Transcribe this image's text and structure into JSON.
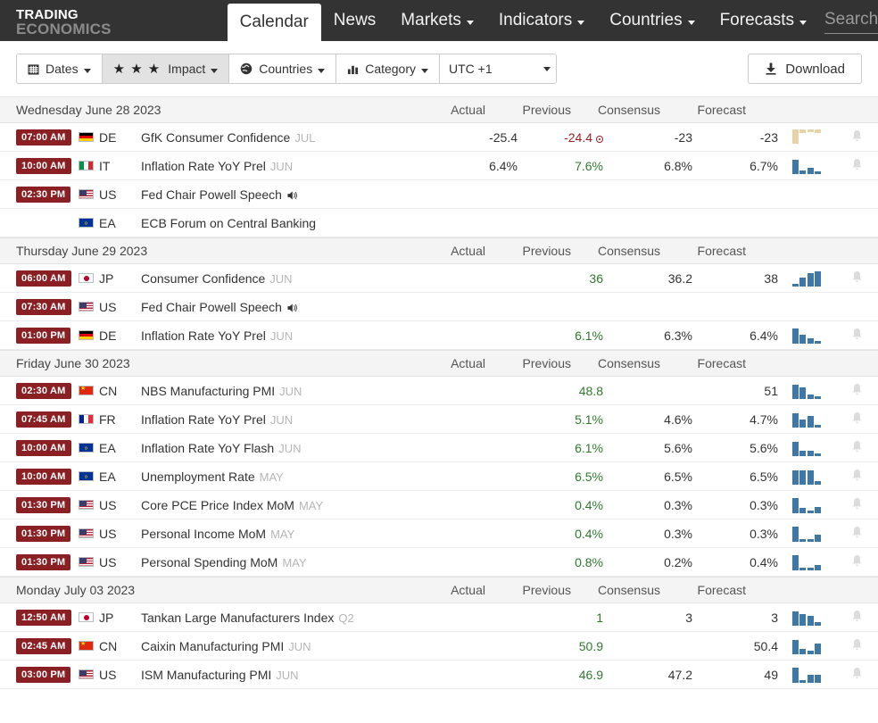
{
  "nav": {
    "brand_line1": "TRADING",
    "brand_line2": "ECONOMICS",
    "items": [
      {
        "label": "Calendar",
        "active": true,
        "caret": false
      },
      {
        "label": "News",
        "active": false,
        "caret": false
      },
      {
        "label": "Markets",
        "active": false,
        "caret": true
      },
      {
        "label": "Indicators",
        "active": false,
        "caret": true
      },
      {
        "label": "Countries",
        "active": false,
        "caret": true
      },
      {
        "label": "Forecasts",
        "active": false,
        "caret": true
      }
    ],
    "search_placeholder": "Search"
  },
  "toolbar": {
    "dates_label": "Dates",
    "impact_label": "Impact",
    "impact_stars": "★ ★ ★",
    "countries_label": "Countries",
    "category_label": "Category",
    "timezone_selected": "UTC +1",
    "timezone_options": [
      "UTC +1"
    ],
    "download_label": "Download"
  },
  "columns": {
    "actual": "Actual",
    "previous": "Previous",
    "consensus": "Consensus",
    "forecast": "Forecast"
  },
  "groups": [
    {
      "date": "Wednesday June 28 2023",
      "rows": [
        {
          "time": "07:00 AM",
          "country": "DE",
          "flag": "de",
          "event": "GfK Consumer Confidence",
          "period": "JUL",
          "actual": "-25.4",
          "actual_color": "plain",
          "previous": "-24.4",
          "previous_color": "red",
          "revised": true,
          "consensus": "-23",
          "forecast": "-23",
          "spark": {
            "color": "tan",
            "bars": [
              16,
              4,
              3,
              4
            ]
          },
          "bell": true
        },
        {
          "time": "10:00 AM",
          "country": "IT",
          "flag": "it",
          "event": "Inflation Rate YoY Prel",
          "period": "JUN",
          "actual": "6.4%",
          "actual_color": "plain",
          "previous": "7.6%",
          "previous_color": "green",
          "revised": false,
          "consensus": "6.8%",
          "forecast": "6.7%",
          "spark": {
            "color": "blue",
            "bars": [
              16,
              4,
              7,
              3
            ]
          },
          "bell": true
        },
        {
          "time": "02:30 PM",
          "country": "US",
          "flag": "us",
          "event": "Fed Chair Powell Speech",
          "period": "",
          "speaker": true,
          "actual": "",
          "previous": "",
          "consensus": "",
          "forecast": "",
          "spark": null,
          "bell": false
        },
        {
          "time": "",
          "country": "EA",
          "flag": "ea",
          "event": "ECB Forum on Central Banking",
          "period": "",
          "actual": "",
          "previous": "",
          "consensus": "",
          "forecast": "",
          "spark": null,
          "bell": false
        }
      ]
    },
    {
      "date": "Thursday June 29 2023",
      "rows": [
        {
          "time": "06:00 AM",
          "country": "JP",
          "flag": "jp",
          "event": "Consumer Confidence",
          "period": "JUN",
          "actual": "",
          "actual_color": "plain",
          "previous": "36",
          "previous_color": "green",
          "revised": false,
          "consensus": "36.2",
          "forecast": "38",
          "spark": {
            "color": "blue",
            "bars": [
              3,
              10,
              15,
              17
            ]
          },
          "bell": true
        },
        {
          "time": "07:30 AM",
          "country": "US",
          "flag": "us",
          "event": "Fed Chair Powell Speech",
          "period": "",
          "speaker": true,
          "actual": "",
          "previous": "",
          "consensus": "",
          "forecast": "",
          "spark": null,
          "bell": false
        },
        {
          "time": "01:00 PM",
          "country": "DE",
          "flag": "de",
          "event": "Inflation Rate YoY Prel",
          "period": "JUN",
          "actual": "",
          "actual_color": "plain",
          "previous": "6.1%",
          "previous_color": "green",
          "revised": false,
          "consensus": "6.3%",
          "forecast": "6.4%",
          "spark": {
            "color": "blue",
            "bars": [
              17,
              10,
              6,
              3
            ]
          },
          "bell": true
        }
      ]
    },
    {
      "date": "Friday June 30 2023",
      "rows": [
        {
          "time": "02:30 AM",
          "country": "CN",
          "flag": "cn",
          "event": "NBS Manufacturing PMI",
          "period": "JUN",
          "actual": "",
          "actual_color": "plain",
          "previous": "48.8",
          "previous_color": "green",
          "revised": false,
          "consensus": "",
          "forecast": "51",
          "spark": {
            "color": "blue",
            "bars": [
              16,
              13,
              5,
              3
            ]
          },
          "bell": true
        },
        {
          "time": "07:45 AM",
          "country": "FR",
          "flag": "fr",
          "event": "Inflation Rate YoY Prel",
          "period": "JUN",
          "actual": "",
          "actual_color": "plain",
          "previous": "5.1%",
          "previous_color": "green",
          "revised": false,
          "consensus": "4.6%",
          "forecast": "4.7%",
          "spark": {
            "color": "blue",
            "bars": [
              16,
              9,
              13,
              3
            ]
          },
          "bell": true
        },
        {
          "time": "10:00 AM",
          "country": "EA",
          "flag": "ea",
          "event": "Inflation Rate YoY Flash",
          "period": "JUN",
          "actual": "",
          "actual_color": "plain",
          "previous": "6.1%",
          "previous_color": "green",
          "revised": false,
          "consensus": "5.6%",
          "forecast": "5.6%",
          "spark": {
            "color": "blue",
            "bars": [
              16,
              6,
              6,
              3
            ]
          },
          "bell": true
        },
        {
          "time": "10:00 AM",
          "country": "EA",
          "flag": "ea",
          "event": "Unemployment Rate",
          "period": "MAY",
          "actual": "",
          "actual_color": "plain",
          "previous": "6.5%",
          "previous_color": "green",
          "revised": false,
          "consensus": "6.5%",
          "forecast": "6.5%",
          "spark": {
            "color": "blue",
            "bars": [
              16,
              16,
              16,
              4
            ]
          },
          "bell": true
        },
        {
          "time": "01:30 PM",
          "country": "US",
          "flag": "us",
          "event": "Core PCE Price Index MoM",
          "period": "MAY",
          "actual": "",
          "actual_color": "plain",
          "previous": "0.4%",
          "previous_color": "green",
          "revised": false,
          "consensus": "0.3%",
          "forecast": "0.3%",
          "spark": {
            "color": "blue",
            "bars": [
              17,
              6,
              3,
              7
            ]
          },
          "bell": true
        },
        {
          "time": "01:30 PM",
          "country": "US",
          "flag": "us",
          "event": "Personal Income MoM",
          "period": "MAY",
          "actual": "",
          "actual_color": "plain",
          "previous": "0.4%",
          "previous_color": "green",
          "revised": false,
          "consensus": "0.3%",
          "forecast": "0.3%",
          "spark": {
            "color": "blue",
            "bars": [
              17,
              3,
              3,
              8
            ]
          },
          "bell": true
        },
        {
          "time": "01:30 PM",
          "country": "US",
          "flag": "us",
          "event": "Personal Spending MoM",
          "period": "MAY",
          "actual": "",
          "actual_color": "plain",
          "previous": "0.8%",
          "previous_color": "green",
          "revised": false,
          "consensus": "0.2%",
          "forecast": "0.4%",
          "spark": {
            "color": "blue",
            "bars": [
              17,
              3,
              3,
              6
            ]
          },
          "bell": true
        }
      ]
    },
    {
      "date": "Monday July 03 2023",
      "rows": [
        {
          "time": "12:50 AM",
          "country": "JP",
          "flag": "jp",
          "event": "Tankan Large Manufacturers Index",
          "period": "Q2",
          "actual": "",
          "actual_color": "plain",
          "previous": "1",
          "previous_color": "green",
          "revised": false,
          "consensus": "3",
          "forecast": "3",
          "spark": {
            "color": "blue",
            "bars": [
              16,
              13,
              11,
              4
            ]
          },
          "bell": true
        },
        {
          "time": "02:45 AM",
          "country": "CN",
          "flag": "cn",
          "event": "Caixin Manufacturing PMI",
          "period": "JUN",
          "actual": "",
          "actual_color": "plain",
          "previous": "50.9",
          "previous_color": "green",
          "revised": false,
          "consensus": "",
          "forecast": "50.4",
          "spark": {
            "color": "blue",
            "bars": [
              16,
              6,
              4,
              12
            ]
          },
          "bell": true
        },
        {
          "time": "03:00 PM",
          "country": "US",
          "flag": "us",
          "event": "ISM Manufacturing PMI",
          "period": "JUN",
          "actual": "",
          "actual_color": "plain",
          "previous": "46.9",
          "previous_color": "green",
          "revised": false,
          "consensus": "47.2",
          "forecast": "49",
          "spark": {
            "color": "blue",
            "bars": [
              17,
              3,
              9,
              9
            ]
          },
          "bell": true
        }
      ]
    }
  ],
  "icons": {
    "dates": "calendar-icon",
    "countries": "globe-icon",
    "category": "bar-chart-icon",
    "download": "download-icon",
    "speaker": "speaker-icon",
    "bell": "bell-icon"
  },
  "colors": {
    "nav_bg": "#333333",
    "time_badge": "#8b2024",
    "value_green": "#2e7a2e",
    "value_red": "#9c2024",
    "spark_blue": "#3f77a8",
    "spark_tan": "#e8d3a8"
  }
}
